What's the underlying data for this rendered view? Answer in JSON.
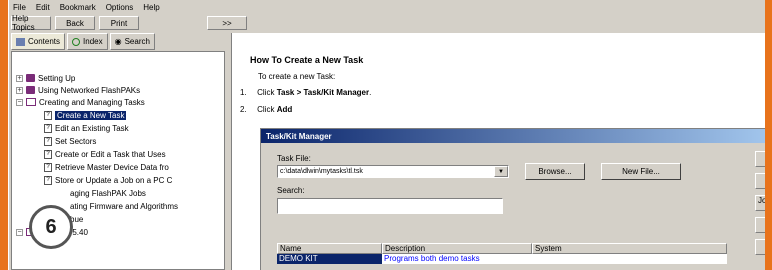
{
  "menu": [
    "File",
    "Edit",
    "Bookmark",
    "Options",
    "Help"
  ],
  "toolbar": {
    "help_topics": "Help Topics",
    "back": "Back",
    "print": "Print",
    "extra": ">>"
  },
  "nav_tabs": {
    "contents": "Contents",
    "index": "Index",
    "search": "Search"
  },
  "tree": [
    "Setting Up",
    "Using Networked FlashPAKs",
    "Creating and Managing Tasks",
    "Create a New Task",
    "Edit an Existing Task",
    "Set Sectors",
    "Create or Edit a Task that Uses",
    "Retrieve Master Device Data fro",
    "Store or Update a Job on a PC C",
    "aging FlashPAK Jobs",
    "ating Firmware and Algorithms",
    "bue",
    "TaskLink 5.40"
  ],
  "badge": "6",
  "content": {
    "title": "How To Create a New Task",
    "intro": "To create a new Task:",
    "step1_num": "1.",
    "step1_a": "Click ",
    "step1_b": "Task > Task/Kit Manager",
    "step1_c": ".",
    "step2_num": "2.",
    "step2_a": "Click ",
    "step2_b": "Add"
  },
  "dialog": {
    "title": "Task/Kit Manager",
    "task_file_label": "Task File:",
    "task_file_value": "c:\\data\\dlwin\\mytasks\\tl.tsk",
    "browse": "Browse...",
    "new_file": "New File...",
    "search_label": "Search:",
    "search_value": "",
    "columns": [
      "Name",
      "Description",
      "System"
    ],
    "row": {
      "name": "DEMO KIT",
      "description": "Programs both demo tasks",
      "system": ""
    },
    "side_button": "Jo"
  }
}
